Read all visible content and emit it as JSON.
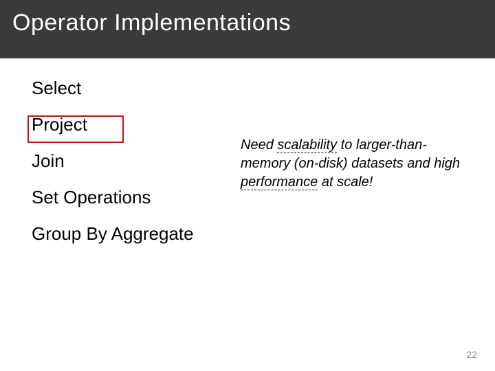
{
  "title": "Operator Implementations",
  "operators": [
    "Select",
    "Project",
    "Join",
    "Set Operations",
    "Group By Aggregate"
  ],
  "highlighted_operator_index": 1,
  "note": {
    "pre1": "Need ",
    "u1": "scalability",
    "mid1": " to larger-than-memory (on-disk) datasets and high ",
    "u2": "performance",
    "post": " at scale!"
  },
  "page_number": "22"
}
